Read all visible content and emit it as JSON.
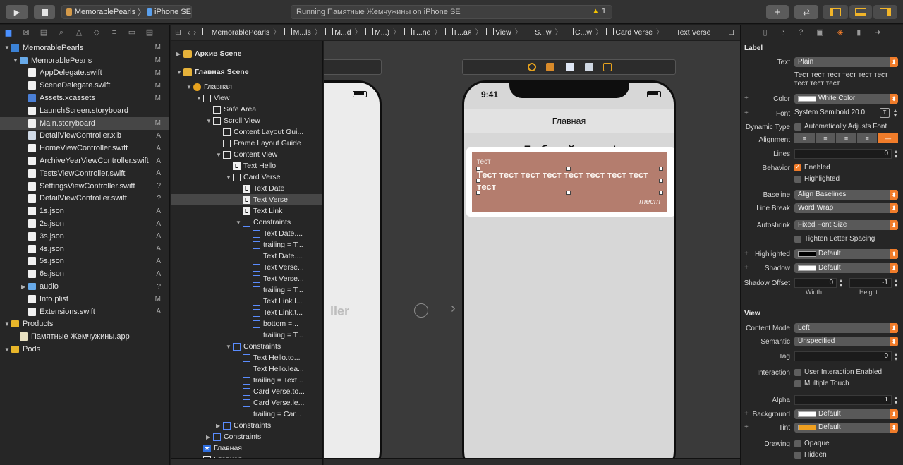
{
  "toolbar": {
    "scheme_project": "MemorablePearls",
    "scheme_device": "iPhone SE",
    "status_text": "Running Памятные Жемчужины on iPhone SE",
    "warning_count": "1"
  },
  "navigator": {
    "items": [
      {
        "label": "MemorablePearls",
        "badge": "M",
        "depth": 0,
        "icon": "project-icon",
        "open": true
      },
      {
        "label": "MemorablePearls",
        "badge": "M",
        "depth": 1,
        "icon": "folder-icon",
        "open": true
      },
      {
        "label": "AppDelegate.swift",
        "badge": "M",
        "depth": 2,
        "icon": "swift-file-icon"
      },
      {
        "label": "SceneDelegate.swift",
        "badge": "M",
        "depth": 2,
        "icon": "swift-file-icon"
      },
      {
        "label": "Assets.xcassets",
        "badge": "M",
        "depth": 2,
        "icon": "assets-icon"
      },
      {
        "label": "LaunchScreen.storyboard",
        "badge": "",
        "depth": 2,
        "icon": "storyboard-icon"
      },
      {
        "label": "Main.storyboard",
        "badge": "M",
        "depth": 2,
        "icon": "storyboard-icon",
        "selected": true
      },
      {
        "label": "DetailViewController.xib",
        "badge": "A",
        "depth": 2,
        "icon": "xib-icon"
      },
      {
        "label": "HomeViewController.swift",
        "badge": "A",
        "depth": 2,
        "icon": "swift-file-icon"
      },
      {
        "label": "ArchiveYearViewController.swift",
        "badge": "A",
        "depth": 2,
        "icon": "swift-file-icon"
      },
      {
        "label": "TestsViewController.swift",
        "badge": "A",
        "depth": 2,
        "icon": "swift-file-icon"
      },
      {
        "label": "SettingsViewController.swift",
        "badge": "?",
        "depth": 2,
        "icon": "swift-file-icon"
      },
      {
        "label": "DetailViewController.swift",
        "badge": "?",
        "depth": 2,
        "icon": "swift-file-icon"
      },
      {
        "label": "1s.json",
        "badge": "A",
        "depth": 2,
        "icon": "json-file-icon"
      },
      {
        "label": "2s.json",
        "badge": "A",
        "depth": 2,
        "icon": "json-file-icon"
      },
      {
        "label": "3s.json",
        "badge": "A",
        "depth": 2,
        "icon": "json-file-icon"
      },
      {
        "label": "4s.json",
        "badge": "A",
        "depth": 2,
        "icon": "json-file-icon"
      },
      {
        "label": "5s.json",
        "badge": "A",
        "depth": 2,
        "icon": "json-file-icon"
      },
      {
        "label": "6s.json",
        "badge": "A",
        "depth": 2,
        "icon": "json-file-icon"
      },
      {
        "label": "audio",
        "badge": "?",
        "depth": 2,
        "icon": "folder-icon",
        "collapsed": true
      },
      {
        "label": "Info.plist",
        "badge": "M",
        "depth": 2,
        "icon": "plist-file-icon"
      },
      {
        "label": "Extensions.swift",
        "badge": "A",
        "depth": 2,
        "icon": "swift-file-icon"
      },
      {
        "label": "Products",
        "badge": "",
        "depth": 0,
        "icon": "yellow-folder-icon",
        "open": true,
        "offset": 1
      },
      {
        "label": "Памятные Жемчужины.app",
        "badge": "",
        "depth": 1,
        "icon": "app-icon",
        "offset": 1
      },
      {
        "label": "Pods",
        "badge": "",
        "depth": 0,
        "icon": "yellow-folder-icon",
        "open": true,
        "offset": 1
      }
    ]
  },
  "jumpbar": {
    "items": [
      "MemorablePearls",
      "M...ls",
      "M...d",
      "M...)",
      "Г...ne",
      "Г...ая",
      "View",
      "S...w",
      "C...w",
      "Card Verse",
      "Text Verse"
    ]
  },
  "outline": {
    "rows": [
      {
        "label": "Архив Scene",
        "depth": 0,
        "icon": "scene",
        "arrow": "right",
        "section": true
      },
      {
        "label": "Главная Scene",
        "depth": 0,
        "icon": "scene",
        "arrow": "down",
        "section": true
      },
      {
        "label": "Главная",
        "depth": 1,
        "icon": "vc",
        "arrow": "down"
      },
      {
        "label": "View",
        "depth": 2,
        "icon": "box",
        "arrow": "down"
      },
      {
        "label": "Safe Area",
        "depth": 3,
        "icon": "box"
      },
      {
        "label": "Scroll View",
        "depth": 3,
        "icon": "box",
        "arrow": "down"
      },
      {
        "label": "Content Layout Gui...",
        "depth": 4,
        "icon": "box"
      },
      {
        "label": "Frame Layout Guide",
        "depth": 4,
        "icon": "box"
      },
      {
        "label": "Content View",
        "depth": 4,
        "icon": "box",
        "arrow": "down"
      },
      {
        "label": "Text Hello",
        "depth": 5,
        "icon": "lab"
      },
      {
        "label": "Card Verse",
        "depth": 5,
        "icon": "box",
        "arrow": "down"
      },
      {
        "label": "Text Date",
        "depth": 6,
        "icon": "lab"
      },
      {
        "label": "Text Verse",
        "depth": 6,
        "icon": "lab",
        "selected": true
      },
      {
        "label": "Text Link",
        "depth": 6,
        "icon": "lab"
      },
      {
        "label": "Constraints",
        "depth": 6,
        "icon": "con",
        "arrow": "down"
      },
      {
        "label": "Text Date....",
        "depth": 7,
        "icon": "con"
      },
      {
        "label": "trailing = T...",
        "depth": 7,
        "icon": "con"
      },
      {
        "label": "Text Date....",
        "depth": 7,
        "icon": "con"
      },
      {
        "label": "Text Verse...",
        "depth": 7,
        "icon": "con"
      },
      {
        "label": "Text Verse...",
        "depth": 7,
        "icon": "con"
      },
      {
        "label": "trailing = T...",
        "depth": 7,
        "icon": "con"
      },
      {
        "label": "Text Link.l...",
        "depth": 7,
        "icon": "con"
      },
      {
        "label": "Text Link.t...",
        "depth": 7,
        "icon": "con"
      },
      {
        "label": "bottom =...",
        "depth": 7,
        "icon": "con"
      },
      {
        "label": "trailing = T...",
        "depth": 7,
        "icon": "con"
      },
      {
        "label": "Constraints",
        "depth": 5,
        "icon": "con",
        "arrow": "down"
      },
      {
        "label": "Text Hello.to...",
        "depth": 6,
        "icon": "con"
      },
      {
        "label": "Text Hello.lea...",
        "depth": 6,
        "icon": "con"
      },
      {
        "label": "trailing = Text...",
        "depth": 6,
        "icon": "con"
      },
      {
        "label": "Card Verse.to...",
        "depth": 6,
        "icon": "con"
      },
      {
        "label": "Card Verse.le...",
        "depth": 6,
        "icon": "con"
      },
      {
        "label": "trailing = Car...",
        "depth": 6,
        "icon": "con"
      },
      {
        "label": "Constraints",
        "depth": 4,
        "icon": "con",
        "arrow": "right"
      },
      {
        "label": "Constraints",
        "depth": 3,
        "icon": "con",
        "arrow": "right"
      },
      {
        "label": "Главная",
        "depth": 2,
        "icon": "star"
      },
      {
        "label": "Главная",
        "depth": 2,
        "icon": "box"
      }
    ]
  },
  "canvas": {
    "left_partial_text": "ller",
    "phone": {
      "time": "9:41",
      "nav_title": "Главная",
      "greeting": "Добрый день!",
      "card_date": "тест",
      "card_verse": "Тест тест тест тест тест тест тест тест тест",
      "card_link": "тест"
    }
  },
  "inspector": {
    "label_section": "Label",
    "text_label": "Text",
    "text_value": "Plain",
    "text_content": "Тест тест тест тест тест тест тест тест тест",
    "color_label": "Color",
    "color_value": "White Color",
    "color_swatch": "#ffffff",
    "font_label": "Font",
    "font_value": "System Semibold 20.0",
    "dynamic_type_label": "Dynamic Type",
    "dynamic_type_value": "Automatically Adjusts Font",
    "alignment_label": "Alignment",
    "lines_label": "Lines",
    "lines_value": "0",
    "behavior_label": "Behavior",
    "enabled_label": "Enabled",
    "highlighted_label": "Highlighted",
    "baseline_label": "Baseline",
    "baseline_value": "Align Baselines",
    "line_break_label": "Line Break",
    "line_break_value": "Word Wrap",
    "autoshrink_label": "Autoshrink",
    "autoshrink_value": "Fixed Font Size",
    "tighten_label": "Tighten Letter Spacing",
    "highlighted_color_label": "Highlighted",
    "highlighted_color_value": "Default",
    "highlighted_swatch": "#000000",
    "shadow_label": "Shadow",
    "shadow_value": "Default",
    "shadow_swatch": "#ffffff",
    "shadow_offset_label": "Shadow Offset",
    "shadow_w": "0",
    "shadow_h": "-1",
    "width_label": "Width",
    "height_label": "Height",
    "view_section": "View",
    "content_mode_label": "Content Mode",
    "content_mode_value": "Left",
    "semantic_label": "Semantic",
    "semantic_value": "Unspecified",
    "tag_label": "Tag",
    "tag_value": "0",
    "interaction_label": "Interaction",
    "user_interaction_label": "User Interaction Enabled",
    "multiple_touch_label": "Multiple Touch",
    "alpha_label": "Alpha",
    "alpha_value": "1",
    "background_label": "Background",
    "background_value": "Default",
    "background_swatch": "#ffffff",
    "tint_label": "Tint",
    "tint_value": "Default",
    "tint_swatch": "#f0a020",
    "drawing_label": "Drawing",
    "opaque_label": "Opaque",
    "hidden_label": "Hidden"
  }
}
